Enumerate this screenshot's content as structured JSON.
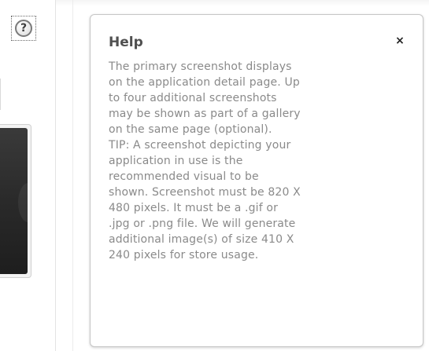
{
  "help_trigger": {
    "glyph": "?",
    "icon": "question-mark-icon"
  },
  "help_popup": {
    "title": "Help",
    "close_glyph": "×",
    "close_icon": "close-icon",
    "lines": [
      "The primary screenshot displays",
      "on the application detail page. Up",
      "to four additional screenshots",
      "may be shown as part of a gallery",
      "on the same page (optional).",
      "TIP: A screenshot depicting your",
      "application in use is the",
      "recommended visual to be",
      "shown. Screenshot must be 820 X",
      "480 pixels. It must be a .gif or",
      ".jpg or .png file. We will generate",
      "additional image(s) of size 410 X",
      "240 pixels for store usage."
    ]
  },
  "colors": {
    "panel_border": "#c6c6c6",
    "title_text": "#505050",
    "body_text": "#8a8a8a",
    "preview_image": "#2a2a2a"
  }
}
